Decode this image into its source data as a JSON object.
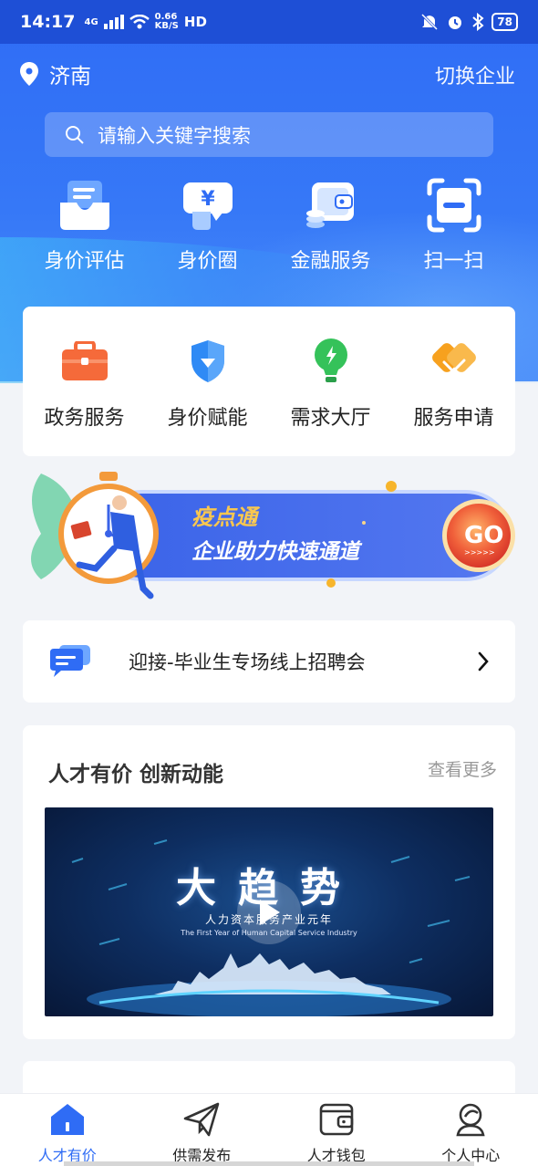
{
  "status_bar": {
    "time": "14:17",
    "network": "4G",
    "speed": "0.66\nKB/S",
    "hd": "HD",
    "battery": "78"
  },
  "header": {
    "location": "济南",
    "switch_label": "切换企业"
  },
  "search": {
    "placeholder": "请输入关键字搜索"
  },
  "quick_actions": [
    {
      "label": "身价评估",
      "icon": "mail-tray-icon"
    },
    {
      "label": "身价圈",
      "icon": "yuan-chat-icon"
    },
    {
      "label": "金融服务",
      "icon": "wallet-coins-icon"
    },
    {
      "label": "扫一扫",
      "icon": "scan-icon"
    }
  ],
  "services": [
    {
      "label": "政务服务",
      "icon": "briefcase-icon",
      "color": "#f56a3a"
    },
    {
      "label": "身价赋能",
      "icon": "shield-icon",
      "color": "#2f8af5"
    },
    {
      "label": "需求大厅",
      "icon": "bulb-icon",
      "color": "#35c25a"
    },
    {
      "label": "服务申请",
      "icon": "handshake-icon",
      "color": "#f7a11e"
    }
  ],
  "banner": {
    "title": "疫点通",
    "subtitle": "企业助力快速通道",
    "go": "GO",
    "go_arrows": ">>>>>"
  },
  "notice": {
    "text": "迎接-毕业生专场线上招聘会"
  },
  "talent": {
    "title": "人才有价 创新动能",
    "more": "查看更多",
    "video": {
      "title": "大趋势",
      "subtitle": "人力资本服务产业元年",
      "english": "The First Year of Human Capital Service Industry"
    }
  },
  "tabbar": [
    {
      "label": "人才有价",
      "icon": "home-icon",
      "active": true
    },
    {
      "label": "供需发布",
      "icon": "paper-plane-icon",
      "active": false
    },
    {
      "label": "人才钱包",
      "icon": "wallet-icon",
      "active": false
    },
    {
      "label": "个人中心",
      "icon": "user-icon",
      "active": false
    }
  ],
  "colors": {
    "primary": "#2f6cf5",
    "background": "#f2f4f8"
  }
}
